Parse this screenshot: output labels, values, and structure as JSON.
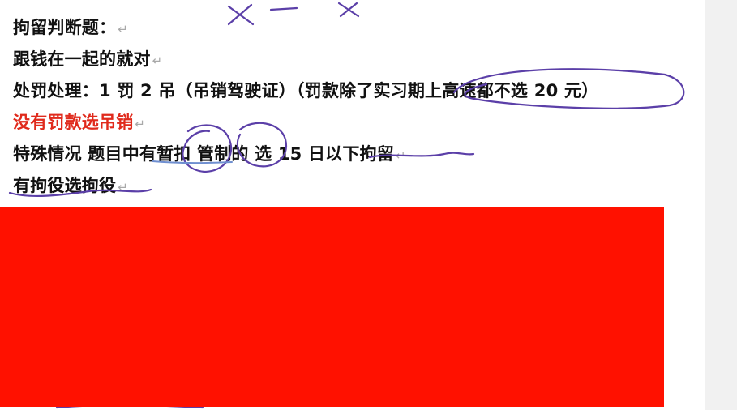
{
  "lines": [
    {
      "text": "拘留判断题：",
      "mark": "↵"
    },
    {
      "text": "跟钱在一起的就对",
      "mark": "↵"
    },
    {
      "text": "处罚处理：1 罚 2 吊（吊销驾驶证）（罚款除了实习期上高速都不选 20 元）",
      "mark": ""
    },
    {
      "text": "没有罚款选吊销",
      "mark": "↵"
    },
    {
      "text": "特殊情况  题目中有暂扣  管制的  选 15 日以下拘留",
      "mark": "↵"
    },
    {
      "text": "有拘役选拘役",
      "mark": "↵"
    }
  ],
  "colors": {
    "text": "#111111",
    "highlight_red": "#e02a1c",
    "redaction": "#ff1100",
    "pen_ink": "#5b3fa8"
  }
}
